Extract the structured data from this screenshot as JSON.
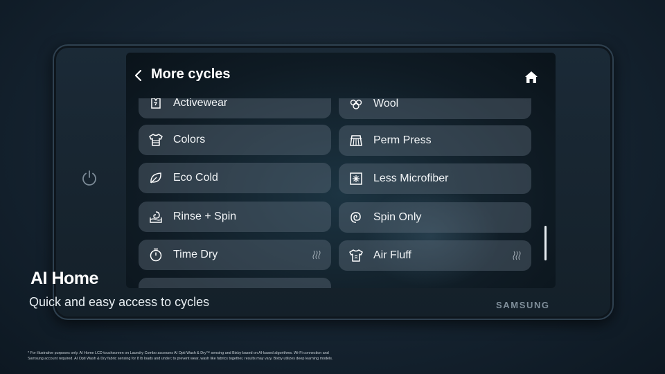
{
  "screen": {
    "title": "More cycles",
    "back_icon": "chevron-left-icon",
    "home_icon": "home-icon"
  },
  "cycles_left": [
    {
      "label": "Activewear",
      "icon": "activewear-icon",
      "dry": false
    },
    {
      "label": "Colors",
      "icon": "shirt-icon",
      "dry": false
    },
    {
      "label": "Eco Cold",
      "icon": "leaf-icon",
      "dry": false
    },
    {
      "label": "Rinse + Spin",
      "icon": "rinse-spin-icon",
      "dry": false
    },
    {
      "label": "Time Dry",
      "icon": "timer-icon",
      "dry": true
    },
    {
      "label": "",
      "icon": "",
      "dry": false
    }
  ],
  "cycles_right": [
    {
      "label": "Wool",
      "icon": "wool-icon",
      "dry": false
    },
    {
      "label": "Perm Press",
      "icon": "perm-press-icon",
      "dry": false
    },
    {
      "label": "Less Microfiber",
      "icon": "microfiber-icon",
      "dry": false
    },
    {
      "label": "Spin Only",
      "icon": "spin-icon",
      "dry": false
    },
    {
      "label": "Air Fluff",
      "icon": "air-fluff-icon",
      "dry": true
    }
  ],
  "brand": "SAMSUNG",
  "caption": {
    "title": "AI Home",
    "subtitle": "Quick and easy access to cycles"
  },
  "disclaimer": {
    "line1": "* For illustrative purposes only. AI Home LCD touchscreen on Laundry Combo accesses AI Opti Wash & Dry™ sensing and Bixby based on AI-based algorithms. Wi-Fi connection and",
    "line2": "Samsung account required.  AI Opti Wash & Dry fabric sensing for 8 lb loads and under; to prevent wear, wash like fabrics together, results may vary. Bixby utilizes deep learning models."
  },
  "colors": {
    "tile": "#5f6e7d",
    "background": "#152330",
    "text": "#ffffff"
  }
}
